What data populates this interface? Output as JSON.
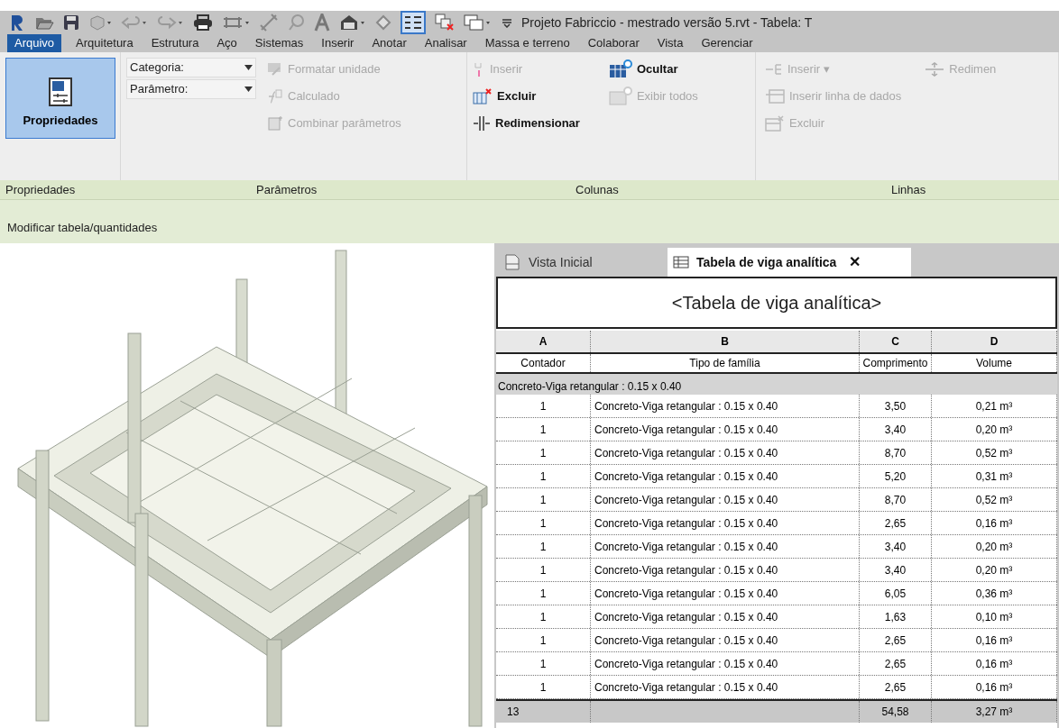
{
  "title_bar": {
    "title": "Projeto Fabriccio - mestrado versão 5.rvt - Tabela: T"
  },
  "menu_tabs": [
    {
      "label": "Arquivo",
      "selected": true
    },
    {
      "label": "Arquitetura",
      "selected": false
    },
    {
      "label": "Estrutura",
      "selected": false
    },
    {
      "label": "Aço",
      "selected": false
    },
    {
      "label": "Sistemas",
      "selected": false
    },
    {
      "label": "Inserir",
      "selected": false
    },
    {
      "label": "Anotar",
      "selected": false
    },
    {
      "label": "Analisar",
      "selected": false
    },
    {
      "label": "Massa e terreno",
      "selected": false
    },
    {
      "label": "Colaborar",
      "selected": false
    },
    {
      "label": "Vista",
      "selected": false
    },
    {
      "label": "Gerenciar",
      "selected": false
    }
  ],
  "ribbon": {
    "panels": [
      {
        "title": "Propriedades",
        "big_button": {
          "label": "Propriedades",
          "selected": true
        }
      },
      {
        "title": "Parâmetros",
        "dropdowns": [
          "Categoria:",
          "Parâmetro:"
        ],
        "items": [
          {
            "label": "Formatar unidade",
            "disabled": true
          },
          {
            "label": "Calculado",
            "disabled": true
          },
          {
            "label": "Combinar parâmetros",
            "disabled": true
          }
        ]
      },
      {
        "title": "Colunas",
        "items": [
          {
            "label": "Inserir",
            "disabled": true
          },
          {
            "label": "Excluir",
            "disabled": false
          },
          {
            "label": "Redimensionar",
            "disabled": false
          },
          {
            "label": "Ocultar",
            "disabled": false
          },
          {
            "label": "Exibir todos",
            "disabled": true
          }
        ]
      },
      {
        "title": "Linhas",
        "items": [
          {
            "label": "Inserir ▾",
            "disabled": true
          },
          {
            "label": "Inserir linha de dados",
            "disabled": true
          },
          {
            "label": "Excluir",
            "disabled": true
          },
          {
            "label": "Redimen",
            "disabled": true
          }
        ]
      }
    ]
  },
  "context_bar": {
    "label": "Modificar tabela/quantidades"
  },
  "view_tabs": [
    {
      "label": "Vista Inicial",
      "selected": false
    },
    {
      "label": "Tabela de viga analítica",
      "selected": true,
      "close": "✕"
    }
  ],
  "schedule": {
    "title": "<Tabela de viga analítica>",
    "column_letters": [
      "A",
      "B",
      "C",
      "D"
    ],
    "columns": [
      "Contador",
      "Tipo de família",
      "Comprimento",
      "Volume"
    ],
    "group_header": "Concreto-Viga retangular : 0.15 x 0.40",
    "rows": [
      [
        "1",
        "Concreto-Viga retangular : 0.15 x 0.40",
        "3,50",
        "0,21 m³"
      ],
      [
        "1",
        "Concreto-Viga retangular : 0.15 x 0.40",
        "3,40",
        "0,20 m³"
      ],
      [
        "1",
        "Concreto-Viga retangular : 0.15 x 0.40",
        "8,70",
        "0,52 m³"
      ],
      [
        "1",
        "Concreto-Viga retangular : 0.15 x 0.40",
        "5,20",
        "0,31 m³"
      ],
      [
        "1",
        "Concreto-Viga retangular : 0.15 x 0.40",
        "8,70",
        "0,52 m³"
      ],
      [
        "1",
        "Concreto-Viga retangular : 0.15 x 0.40",
        "2,65",
        "0,16 m³"
      ],
      [
        "1",
        "Concreto-Viga retangular : 0.15 x 0.40",
        "3,40",
        "0,20 m³"
      ],
      [
        "1",
        "Concreto-Viga retangular : 0.15 x 0.40",
        "3,40",
        "0,20 m³"
      ],
      [
        "1",
        "Concreto-Viga retangular : 0.15 x 0.40",
        "6,05",
        "0,36 m³"
      ],
      [
        "1",
        "Concreto-Viga retangular : 0.15 x 0.40",
        "1,63",
        "0,10 m³"
      ],
      [
        "1",
        "Concreto-Viga retangular : 0.15 x 0.40",
        "2,65",
        "0,16 m³"
      ],
      [
        "1",
        "Concreto-Viga retangular : 0.15 x 0.40",
        "2,65",
        "0,16 m³"
      ],
      [
        "1",
        "Concreto-Viga retangular : 0.15 x 0.40",
        "2,65",
        "0,16 m³"
      ]
    ],
    "totals": {
      "count": "13",
      "length": "54,58",
      "volume": "3,27 m³"
    }
  }
}
